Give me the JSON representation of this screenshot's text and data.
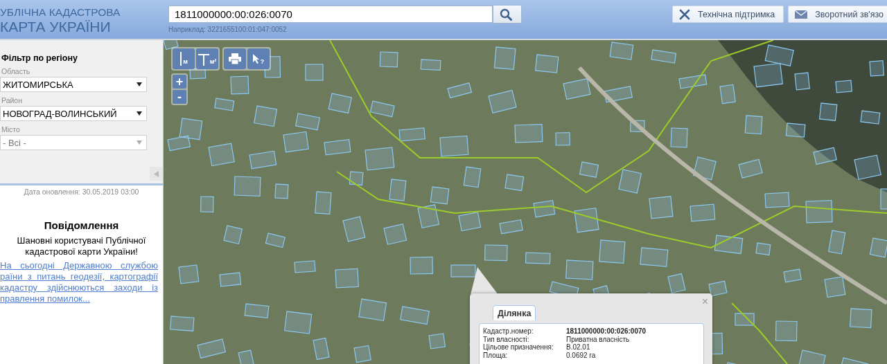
{
  "header": {
    "logo_lines": [
      "УБЛІЧНА КАДАСТРОВА",
      "КАРТА УКРАЇНИ"
    ],
    "search": {
      "value": "1811000000:00:026:0070",
      "hint": "Наприклад: 3221655100:01:047:0052"
    },
    "buttons": [
      {
        "label": "Технічна підтримка",
        "kind": "support"
      },
      {
        "label": "Зворотний зв'язо",
        "kind": "feedback"
      }
    ]
  },
  "sidebar": {
    "filter_title": "Фільтр по регіону",
    "fields": [
      {
        "label": "Область",
        "value": "ЖИТОМИРСЬКА",
        "disabled": false
      },
      {
        "label": "Район",
        "value": "НОВОГРАД-ВОЛИНСЬКИЙ",
        "disabled": false
      },
      {
        "label": "Місто",
        "value": "- Всі -",
        "disabled": true
      }
    ],
    "update_date": "Дата оновлення: 30.05.2019 03:00",
    "notice": {
      "title": "Повідомлення",
      "greeting": "Шановні користувачі Публічної кадастрової карти України!",
      "link_lines": [
        "На сьогодні Державною службою",
        "раїни з питань геодезії, картографії",
        "кадастру здійснюються заходи із",
        "правлення помилок..."
      ]
    }
  },
  "map": {
    "tools": [
      {
        "kind": "length",
        "unit": "м"
      },
      {
        "kind": "area",
        "unit": "м²"
      },
      {
        "kind": "print"
      },
      {
        "kind": "identify",
        "unit": "?"
      }
    ],
    "zoom": [
      "+",
      "-"
    ],
    "popup": {
      "tab": "Ділянка",
      "close": "×",
      "rows": [
        {
          "label": "Кадастр.номер:",
          "value": "1811000000:00:026:0070",
          "bold": true
        },
        {
          "label": "Тип власності:",
          "value": "Приватна власність",
          "bold": false
        },
        {
          "label": "Цільове призначення:",
          "value": "В.02.01",
          "bold": false
        },
        {
          "label": "Площа:",
          "value": "0.0692 га",
          "bold": false
        }
      ]
    }
  }
}
